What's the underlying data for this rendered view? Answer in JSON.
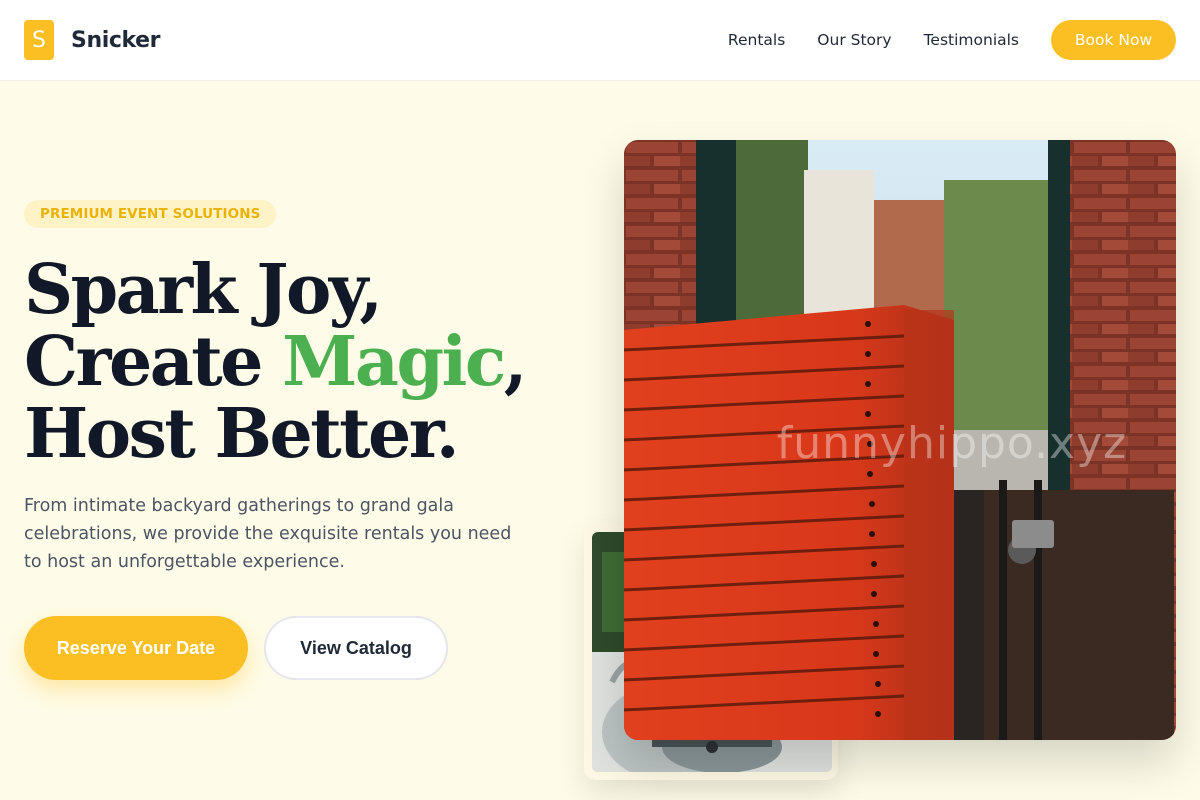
{
  "brand": {
    "logo_letter": "S",
    "name": "Snicker",
    "accent_color": "#fbbf24"
  },
  "nav": {
    "items": [
      {
        "label": "Rentals"
      },
      {
        "label": "Our Story"
      },
      {
        "label": "Testimonials"
      }
    ],
    "book_label": "Book Now"
  },
  "hero": {
    "badge": "PREMIUM EVENT SOLUTIONS",
    "headline_line1": "Spark Joy,",
    "headline_line2_pre": "Create ",
    "headline_line2_accent": "Magic",
    "headline_line2_post": ",",
    "headline_line3": "Host Better.",
    "accent_color": "#4caf50",
    "description": "From intimate backyard gatherings to grand gala celebrations, we provide the exquisite rentals you need to host an unforgettable experience.",
    "primary_cta": "Reserve Your Date",
    "secondary_cta": "View Catalog"
  },
  "media": {
    "main_photo_watermark": "funnyhippo.xyz",
    "main_photo_subject": "stacked red wooden trays against brick wall",
    "secondary_photo_subject": "outdoor event equipment"
  }
}
